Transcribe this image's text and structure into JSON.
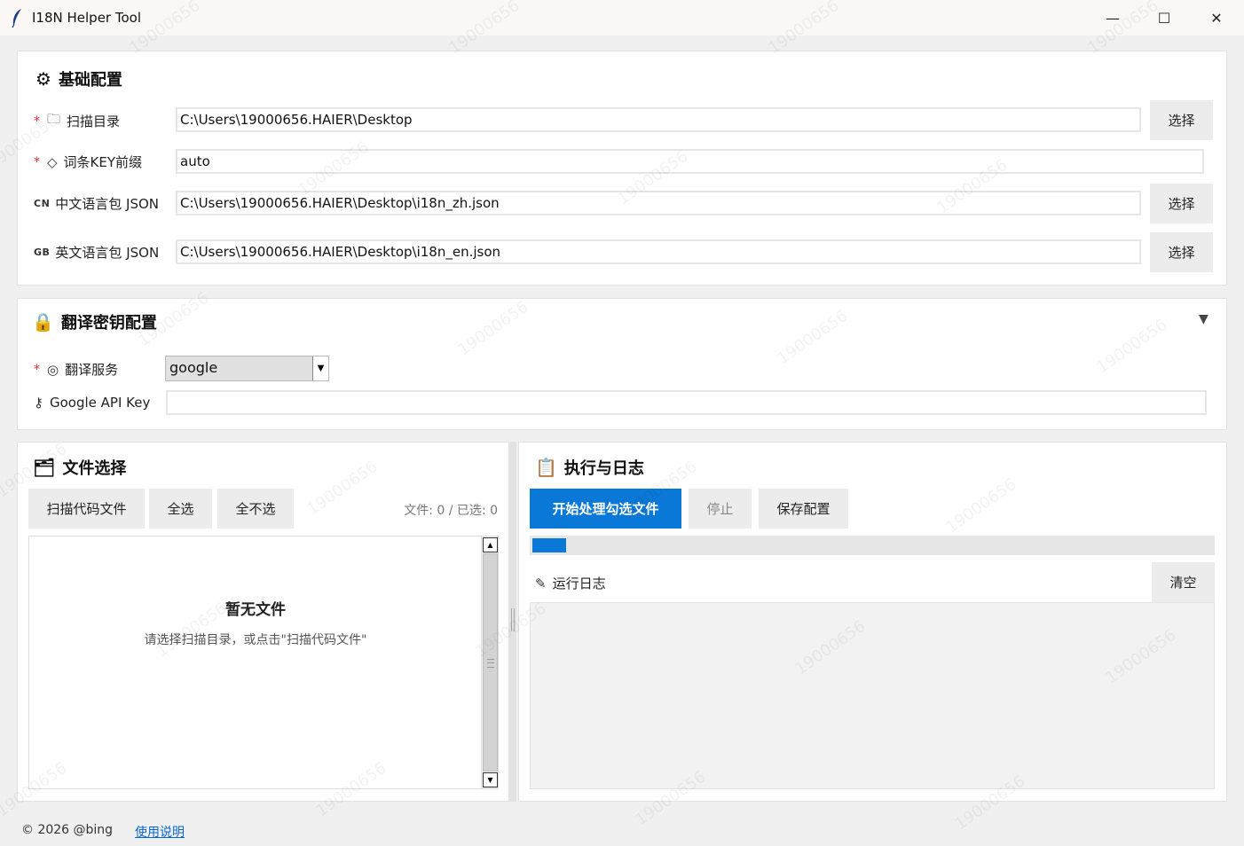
{
  "window": {
    "title": "I18N Helper Tool",
    "min_glyph": "—",
    "max_glyph": "☐",
    "close_glyph": "✕"
  },
  "basic_config": {
    "title": "基础配置",
    "scan_dir": {
      "label": "扫描目录",
      "value": "C:\\Users\\19000656.HAIER\\Desktop",
      "button": "选择"
    },
    "key_prefix": {
      "label": "词条KEY前缀",
      "value": "auto"
    },
    "zh_json": {
      "flag": "CN",
      "label": "中文语言包 JSON",
      "value": "C:\\Users\\19000656.HAIER\\Desktop\\i18n_zh.json",
      "button": "选择"
    },
    "en_json": {
      "flag": "GB",
      "label": "英文语言包 JSON",
      "value": "C:\\Users\\19000656.HAIER\\Desktop\\i18n_en.json",
      "button": "选择"
    }
  },
  "key_config": {
    "title": "翻译密钥配置",
    "service": {
      "label": "翻译服务",
      "selected": "google"
    },
    "api_key": {
      "label": "Google API Key",
      "value": ""
    }
  },
  "file_select": {
    "title": "文件选择",
    "scan_button": "扫描代码文件",
    "select_all": "全选",
    "select_none": "全不选",
    "count_text": "文件: 0 / 已选: 0",
    "empty_title": "暂无文件",
    "empty_hint": "请选择扫描目录，或点击\"扫描代码文件\""
  },
  "execution": {
    "title": "执行与日志",
    "start_button": "开始处理勾选文件",
    "stop_button": "停止",
    "save_button": "保存配置",
    "progress_fraction": 0.05,
    "log_title": "运行日志",
    "clear_button": "清空"
  },
  "footer": {
    "copyright": "© 2026 @bing",
    "help_link": "使用说明"
  },
  "watermark_text": "19000656",
  "colors": {
    "primary": "#0a78d7",
    "required": "#e0282e",
    "link": "#0a66d6"
  }
}
